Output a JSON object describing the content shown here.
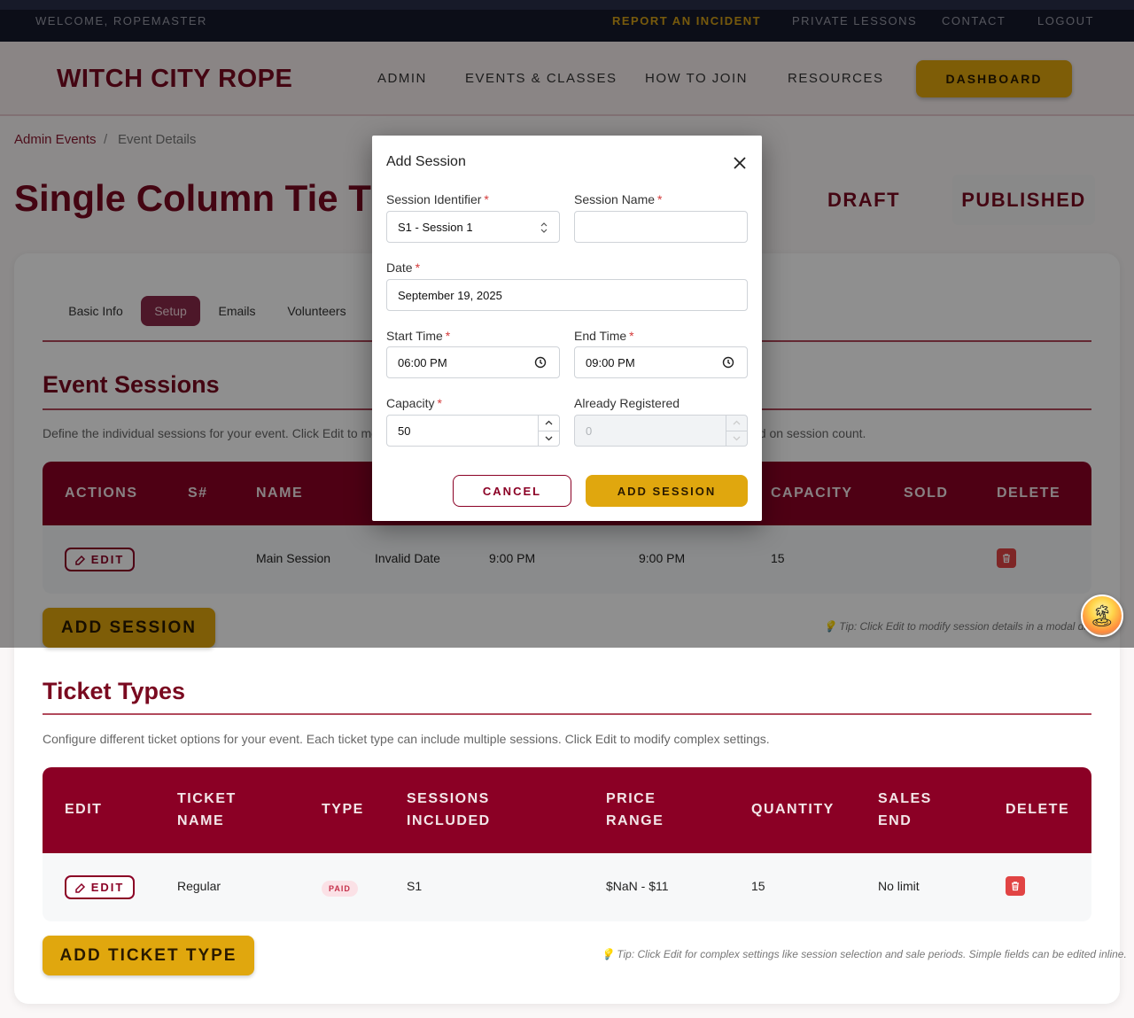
{
  "utility_bar": {
    "welcome": "WELCOME, ROPEMASTER",
    "links": [
      "REPORT AN INCIDENT",
      "PRIVATE LESSONS",
      "CONTACT",
      "LOGOUT"
    ]
  },
  "header": {
    "logo": "WITCH CITY ROPE",
    "nav": [
      "ADMIN",
      "EVENTS & CLASSES",
      "HOW TO JOIN",
      "RESOURCES"
    ],
    "dashboard_label": "DASHBOARD"
  },
  "breadcrumb": {
    "parent": "Admin Events",
    "separator": "/",
    "current": "Event Details"
  },
  "page": {
    "title": "Single Column Tie T",
    "status_draft": "DRAFT",
    "status_published": "PUBLISHED"
  },
  "tabs": [
    "Basic Info",
    "Setup",
    "Emails",
    "Volunteers"
  ],
  "sessions": {
    "title": "Event Sessions",
    "description_start": "Define the individual sessions for your event. Click Edit to mod",
    "description_end": "ed on session count.",
    "headers": [
      "ACTIONS",
      "S#",
      "NAME",
      "CAPACITY",
      "SOLD",
      "DELETE"
    ],
    "row": {
      "edit_label": "EDIT",
      "name": "Main Session",
      "date": "Invalid Date",
      "start": "9:00 PM",
      "end": "9:00 PM",
      "capacity": "15"
    },
    "add_label": "ADD SESSION",
    "tip": "💡 Tip: Click Edit to modify session details in a modal dialog."
  },
  "tickets": {
    "title": "Ticket Types",
    "description": "Configure different ticket options for your event. Each ticket type can include multiple sessions. Click Edit to modify complex settings.",
    "headers": {
      "edit": "EDIT",
      "name_1": "TICKET",
      "name_2": "NAME",
      "type": "TYPE",
      "sessions_1": "SESSIONS",
      "sessions_2": "INCLUDED",
      "price_1": "PRICE",
      "price_2": "RANGE",
      "quantity": "QUANTITY",
      "sales_1": "SALES",
      "sales_2": "END",
      "delete": "DELETE"
    },
    "row": {
      "edit_label": "EDIT",
      "name": "Regular",
      "type_badge": "PAID",
      "sessions": "S1",
      "price": "$NaN - $11",
      "quantity": "15",
      "sales_end": "No limit"
    },
    "add_label": "ADD TICKET TYPE",
    "tip": "💡 Tip: Click Edit for complex settings like session selection and sale periods. Simple fields can be edited inline."
  },
  "modal": {
    "title": "Add Session",
    "fields": {
      "session_identifier": {
        "label": "Session Identifier",
        "value": "S1 - Session 1"
      },
      "session_name": {
        "label": "Session Name",
        "value": ""
      },
      "date": {
        "label": "Date",
        "value": "September 19, 2025"
      },
      "start_time": {
        "label": "Start Time",
        "value": "06:00 PM"
      },
      "end_time": {
        "label": "End Time",
        "value": "09:00 PM"
      },
      "capacity": {
        "label": "Capacity",
        "value": "50"
      },
      "already_registered": {
        "label": "Already Registered",
        "value": "0"
      }
    },
    "required_mark": "*",
    "cancel_label": "CANCEL",
    "submit_label": "ADD SESSION"
  },
  "colors": {
    "brand": "#8b0025",
    "accent": "#e0a70e",
    "danger": "#e14444"
  },
  "icons": [
    "close-icon",
    "clock-icon",
    "edit-icon",
    "trash-icon",
    "chevron-updown-icon"
  ]
}
